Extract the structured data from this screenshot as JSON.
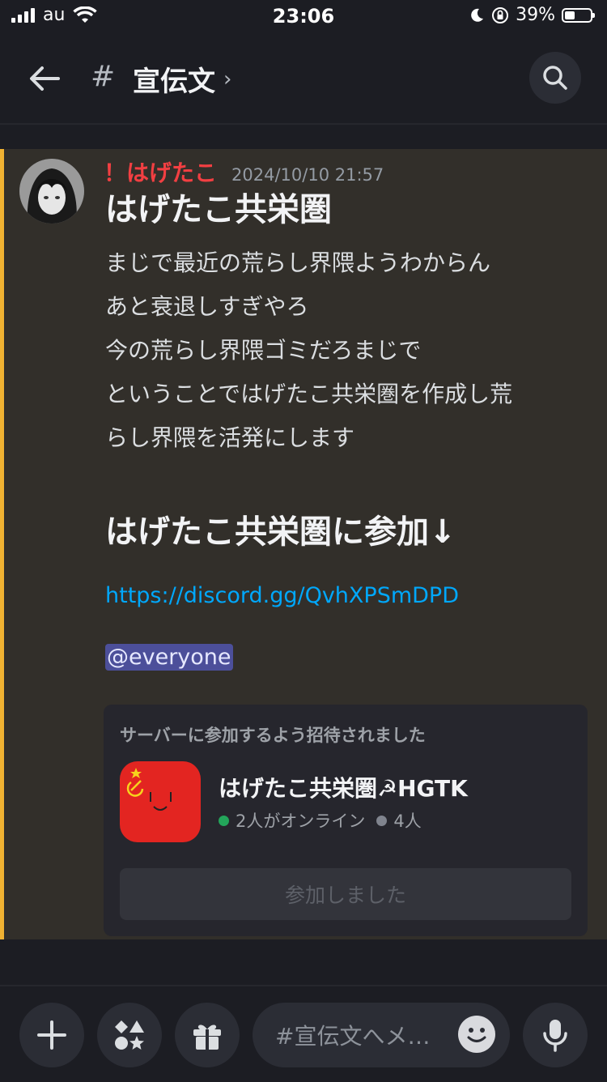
{
  "status_bar": {
    "carrier": "au",
    "time": "23:06",
    "battery_percent": "39%",
    "battery_level": 0.39
  },
  "header": {
    "channel_prefix": "#",
    "channel_name": "宣伝文",
    "chevron": "›"
  },
  "message": {
    "author": "！はげたこ",
    "author_color": "#f23f42",
    "timestamp": "2024/10/10 21:57",
    "heading": "はげたこ共栄圏",
    "lines": [
      "まじで最近の荒らし界隈ようわからん",
      "あと衰退しすぎやろ",
      "今の荒らし界隈ゴミだろまじで",
      "ということではげたこ共栄圏を作成し荒",
      "らし界隈を活発にします"
    ],
    "heading2": "はげたこ共栄圏に参加↓",
    "link": "https://discord.gg/QvhXPSmDPD",
    "mention": "@everyone"
  },
  "invite": {
    "header": "サーバーに参加するよう招待されました",
    "server_name": "はげたこ共栄圏☭HGTK",
    "online": "2人がオンライン",
    "members": "4人",
    "join_label": "参加しました"
  },
  "composer": {
    "placeholder": "#宣伝文へメ…"
  },
  "icons": [
    "signal-icon",
    "wifi-icon",
    "moon-icon",
    "orientation-lock-icon",
    "battery-icon",
    "back-arrow-icon",
    "search-icon",
    "plus-icon",
    "apps-icon",
    "gift-icon",
    "emoji-icon",
    "microphone-icon"
  ],
  "colors": {
    "accent_bar": "#f0b232",
    "link": "#00a8fc",
    "mention_bg": "#4c4f9a",
    "online": "#23a55a",
    "server_icon": "#e32521"
  }
}
